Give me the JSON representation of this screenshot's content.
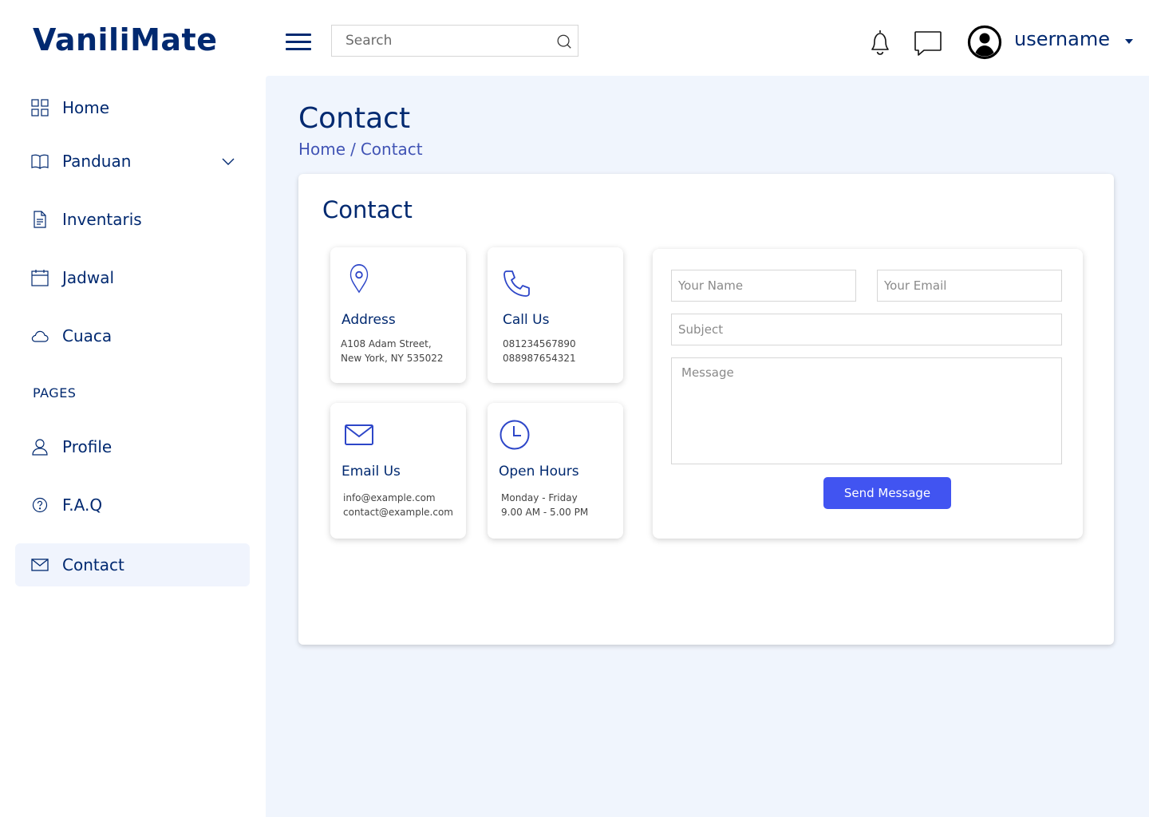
{
  "brand": {
    "name": "VaniliMate"
  },
  "header": {
    "search_placeholder": "Search",
    "username": "username"
  },
  "sidebar": {
    "items": [
      {
        "label": "Home",
        "icon": "grid-icon"
      },
      {
        "label": "Panduan",
        "icon": "book-icon"
      },
      {
        "label": "Inventaris",
        "icon": "document-icon"
      },
      {
        "label": "Jadwal",
        "icon": "calendar-icon"
      },
      {
        "label": "Cuaca",
        "icon": "cloud-icon"
      }
    ],
    "pages_heading": "PAGES",
    "page_items": [
      {
        "label": "Profile",
        "icon": "person-icon"
      },
      {
        "label": "F.A.Q",
        "icon": "question-circle-icon"
      },
      {
        "label": "Contact",
        "icon": "envelope-icon",
        "active": true
      }
    ]
  },
  "page": {
    "title": "Contact",
    "breadcrumb": [
      "Home",
      "Contact"
    ],
    "breadcrumb_separator": "/"
  },
  "contact": {
    "card_title": "Contact",
    "info": [
      {
        "title": "Address",
        "icon": "map-pin-icon",
        "lines": [
          "A108 Adam Street,",
          "New York, NY 535022"
        ]
      },
      {
        "title": "Call Us",
        "icon": "phone-icon",
        "lines": [
          "081234567890",
          "088987654321"
        ]
      },
      {
        "title": "Email Us",
        "icon": "envelope-icon",
        "lines": [
          "info@example.com",
          "contact@example.com"
        ]
      },
      {
        "title": "Open Hours",
        "icon": "clock-icon",
        "lines": [
          "Monday - Friday",
          "9.00 AM - 5.00 PM"
        ]
      }
    ],
    "form": {
      "name_placeholder": "Your Name",
      "email_placeholder": "Your Email",
      "subject_placeholder": "Subject",
      "message_placeholder": "Message",
      "submit_label": "Send Message"
    }
  },
  "colors": {
    "brand": "#012970",
    "accent": "#4154f1",
    "icon_blue": "#2d46c8",
    "main_bg": "#f0f5fd",
    "active_item_bg": "#f0f4fd",
    "breadcrumb": "#4154b5"
  }
}
